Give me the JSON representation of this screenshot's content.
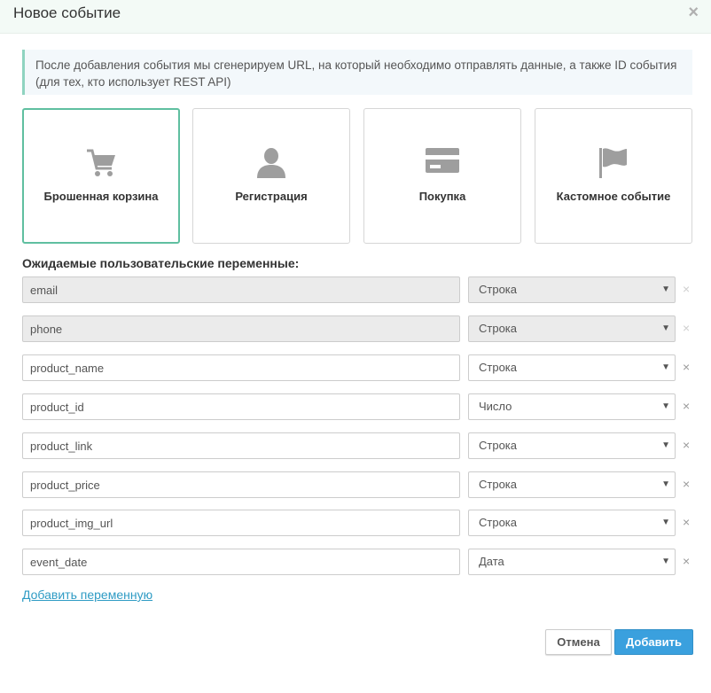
{
  "modal": {
    "title": "Новое событие",
    "close_symbol": "×"
  },
  "info": {
    "text": "После добавления события мы сгенерируем URL, на который необходимо отправлять данные, а также ID события (для тех, кто использует REST API)"
  },
  "event_types": [
    {
      "label": "Брошенная корзина",
      "icon": "cart-icon",
      "selected": true
    },
    {
      "label": "Регистрация",
      "icon": "user-icon",
      "selected": false
    },
    {
      "label": "Покупка",
      "icon": "credit-card-icon",
      "selected": false
    },
    {
      "label": "Кастомное событие",
      "icon": "flag-icon",
      "selected": false
    }
  ],
  "variables": {
    "heading": "Ожидаемые пользовательские переменные:",
    "remove_symbol": "×",
    "arrow_symbol": "▼",
    "rows": [
      {
        "name": "email",
        "type": "Строка",
        "locked": true
      },
      {
        "name": "phone",
        "type": "Строка",
        "locked": true
      },
      {
        "name": "product_name",
        "type": "Строка",
        "locked": false
      },
      {
        "name": "product_id",
        "type": "Число",
        "locked": false
      },
      {
        "name": "product_link",
        "type": "Строка",
        "locked": false
      },
      {
        "name": "product_price",
        "type": "Строка",
        "locked": false
      },
      {
        "name": "product_img_url",
        "type": "Строка",
        "locked": false
      },
      {
        "name": "event_date",
        "type": "Дата",
        "locked": false
      }
    ],
    "add_link": "Добавить переменную"
  },
  "footer": {
    "cancel_label": "Отмена",
    "submit_label": "Добавить"
  },
  "colors": {
    "accent_green": "#5fbfa0",
    "primary_blue": "#3aa0de",
    "link_blue": "#2e9bc4",
    "icon_gray": "#9e9e9e"
  }
}
